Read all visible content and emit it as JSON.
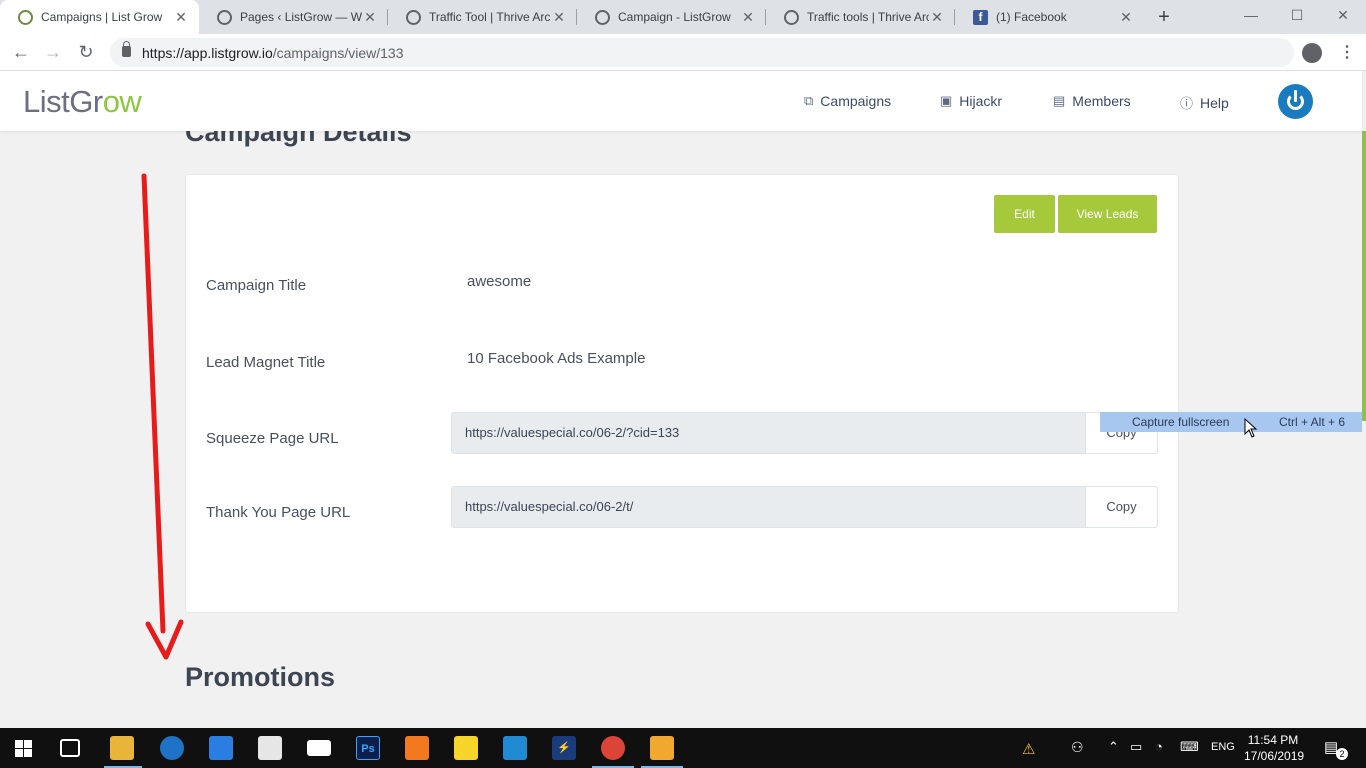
{
  "browser": {
    "tabs": [
      {
        "title": "Campaigns | List Grow",
        "icon": "listgrow-favicon",
        "active": true
      },
      {
        "title": "Pages ‹ ListGrow — Wo",
        "icon": "globe-icon",
        "active": false
      },
      {
        "title": "Traffic Tool | Thrive Arch",
        "icon": "globe-icon",
        "active": false
      },
      {
        "title": "Campaign - ListGrow",
        "icon": "globe-icon",
        "active": false
      },
      {
        "title": "Traffic tools | Thrive Arc",
        "icon": "globe-icon",
        "active": false
      },
      {
        "title": "(1) Facebook",
        "icon": "facebook-icon",
        "active": false
      }
    ],
    "new_tab": "+",
    "window_controls": {
      "minimize": "—",
      "maximize": "☐",
      "close": "✕"
    },
    "nav": {
      "back": "←",
      "forward": "→",
      "reload": "↻"
    },
    "url_host": "https://app.listgrow.io",
    "url_path": "/campaigns/view/133",
    "bookmark_star": "☆",
    "menu": "⋮"
  },
  "site": {
    "logo_main": "ListGr",
    "logo_accent": "ow",
    "nav": [
      {
        "label": "Campaigns",
        "icon": "⧉"
      },
      {
        "label": "Hijackr",
        "icon": "▣"
      },
      {
        "label": "Members",
        "icon": "▤"
      },
      {
        "label": "Help",
        "icon": "ⓘ"
      }
    ],
    "brand_color": "#8dc63f",
    "button_color": "#a5c93a"
  },
  "main": {
    "title": "Campaign Details",
    "edit_label": "Edit",
    "view_leads_label": "View Leads",
    "fields": {
      "campaign_title_label": "Campaign Title",
      "campaign_title_value": "awesome",
      "lead_magnet_label": "Lead Magnet Title",
      "lead_magnet_value": "10 Facebook Ads Example",
      "squeeze_label": "Squeeze Page URL",
      "squeeze_url": "https://valuespecial.co/06-2/?cid=133",
      "thankyou_label": "Thank You Page URL",
      "thankyou_url": "https://valuespecial.co/06-2/t/",
      "copy_label": "Copy"
    },
    "promotions_title": "Promotions"
  },
  "overlay": {
    "capture_label": "Capture fullscreen",
    "capture_shortcut": "Ctrl + Alt + 6",
    "annotation_color": "#e81b1b"
  },
  "taskbar": {
    "apps": [
      "start-icon",
      "task-view-icon",
      "file-explorer-icon",
      "edge-icon",
      "dropbox-icon",
      "store-icon",
      "mail-icon",
      "photoshop-icon",
      "xampp-icon",
      "sticky-notes-icon",
      "vscode-icon",
      "bolt-app-icon",
      "chrome-icon",
      "video-app-icon"
    ],
    "photoshop_label": "Ps",
    "language": "ENG",
    "time": "11:54 PM",
    "date": "17/06/2019",
    "notifications_count": "2"
  }
}
